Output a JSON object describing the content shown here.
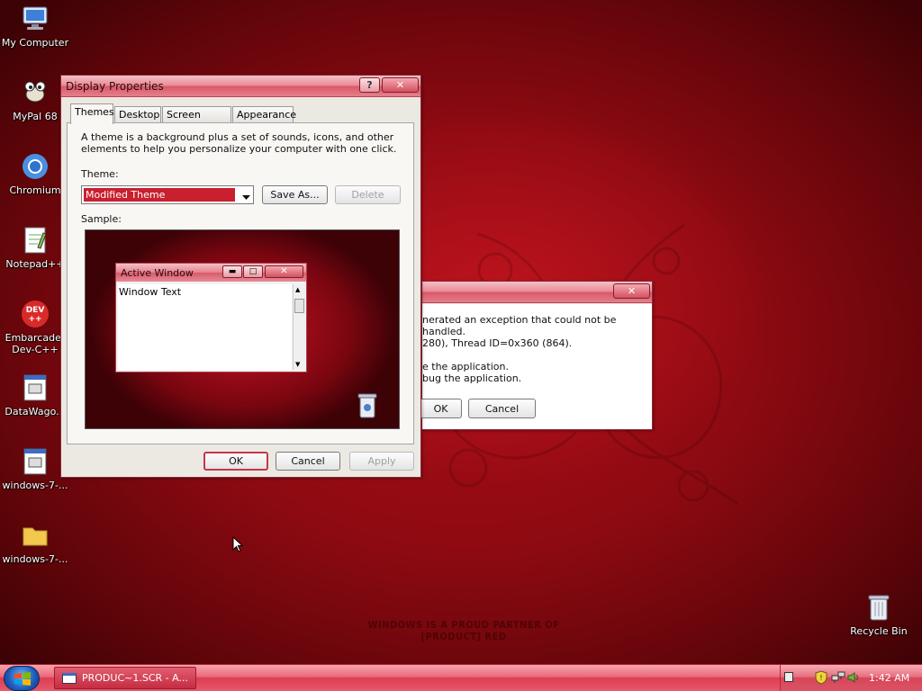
{
  "desktop": {
    "icons": [
      {
        "label": "My Computer",
        "icon": "computer-icon"
      },
      {
        "label": "MyPal 68",
        "icon": "mypal-icon"
      },
      {
        "label": "Chromium",
        "icon": "chromium-icon"
      },
      {
        "label": "Notepad++",
        "icon": "notepad-plus-plus-icon"
      },
      {
        "label": "Embarcadero Dev-C++",
        "line1": "Embarcader",
        "line2": "Dev-C++",
        "icon": "dev-cpp-icon"
      },
      {
        "label": "DataWago...",
        "icon": "datawagon-icon"
      },
      {
        "label": "windows-7-...",
        "icon": "executable-icon"
      },
      {
        "label": "windows-7-...",
        "icon": "folder-icon"
      },
      {
        "label": "Recycle Bin",
        "icon": "recycle-bin-icon"
      }
    ],
    "wallpaper_text": "WINDOWS IS A PROUD PARTNER OF [PRODUCT] RED"
  },
  "display_properties": {
    "title": "Display Properties",
    "tabs": [
      "Themes",
      "Desktop",
      "Screen Saver",
      "Appearance"
    ],
    "active_tab": "Themes",
    "description": "A theme is a background plus a set of sounds, icons, and other elements to help you personalize your computer with one click.",
    "theme_label": "Theme:",
    "theme_value": "Modified Theme",
    "save_as_label": "Save As...",
    "delete_label": "Delete",
    "sample_label": "Sample:",
    "preview": {
      "window_title": "Active Window",
      "window_text": "Window Text"
    },
    "ok_label": "OK",
    "cancel_label": "Cancel",
    "apply_label": "Apply"
  },
  "error_dialog": {
    "line1": "nerated an exception that could not be handled.",
    "line2": "280), Thread ID=0x360 (864).",
    "line3": "e the application.",
    "line4": "bug the application.",
    "ok_label": "OK",
    "cancel_label": "Cancel"
  },
  "taskbar": {
    "task_label": "PRODUC~1.SCR - A...",
    "clock": "1:42 AM"
  },
  "colors": {
    "accent": "#d4283c",
    "desktop": "#9b0c14"
  }
}
